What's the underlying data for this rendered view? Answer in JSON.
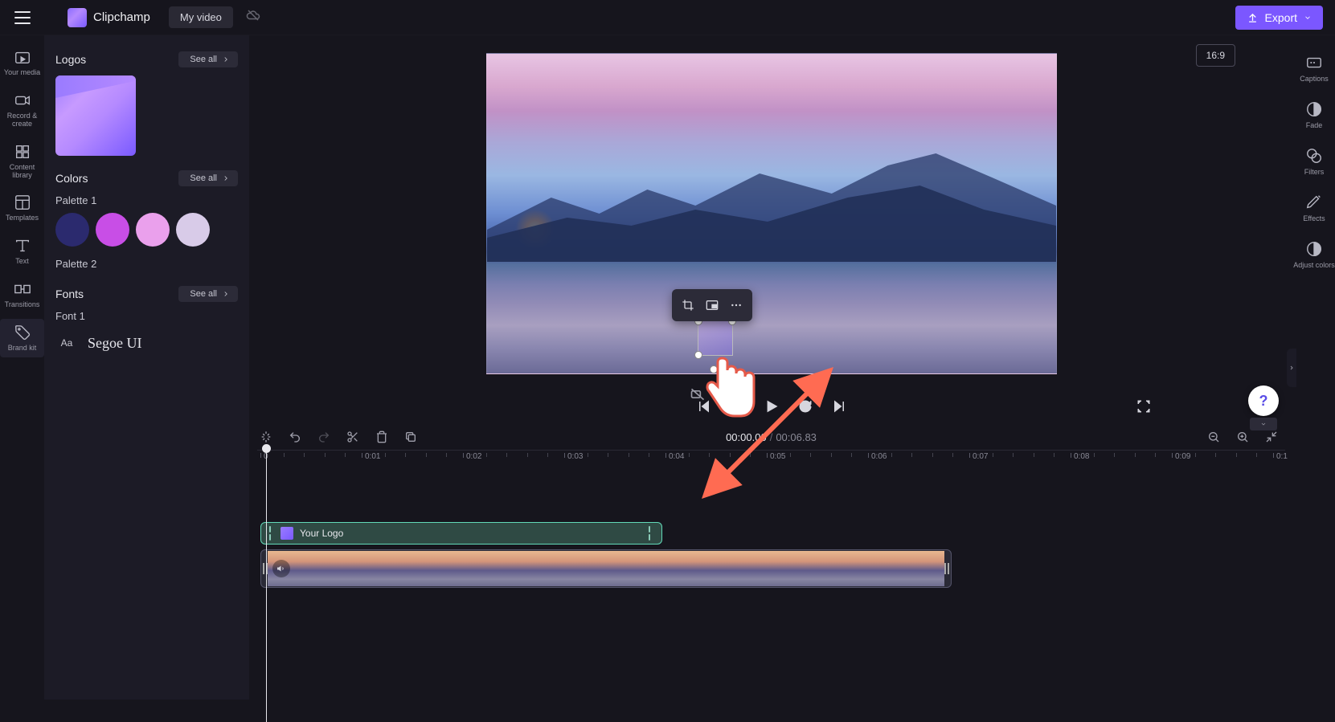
{
  "header": {
    "brand": "Clipchamp",
    "video_title": "My video",
    "export_label": "Export",
    "aspect_ratio": "16:9"
  },
  "leftrail": {
    "items": [
      {
        "label": "Your media"
      },
      {
        "label": "Record & create"
      },
      {
        "label": "Content library"
      },
      {
        "label": "Templates"
      },
      {
        "label": "Text"
      },
      {
        "label": "Transitions"
      },
      {
        "label": "Brand kit"
      }
    ]
  },
  "sidepanel": {
    "see_all": "See all",
    "logos_title": "Logos",
    "colors_title": "Colors",
    "palette1": "Palette 1",
    "palette2": "Palette 2",
    "fonts_title": "Fonts",
    "font1": "Font 1",
    "font_aa": "Aa",
    "font_name": "Segoe UI",
    "swatches": [
      "#2b2a6e",
      "#c84ee6",
      "#eaa0ec",
      "#d8cbe8"
    ]
  },
  "rightrail": {
    "items": [
      {
        "label": "Captions"
      },
      {
        "label": "Fade"
      },
      {
        "label": "Filters"
      },
      {
        "label": "Effects"
      },
      {
        "label": "Adjust colors"
      }
    ]
  },
  "timeline": {
    "current": "00:00.00",
    "duration": "00:06.83",
    "ruler": [
      "0",
      "0:01",
      "0:02",
      "0:03",
      "0:04",
      "0:05",
      "0:06",
      "0:07",
      "0:08",
      "0:09",
      "0:1"
    ],
    "logo_track_label": "Your Logo"
  },
  "help": "?"
}
